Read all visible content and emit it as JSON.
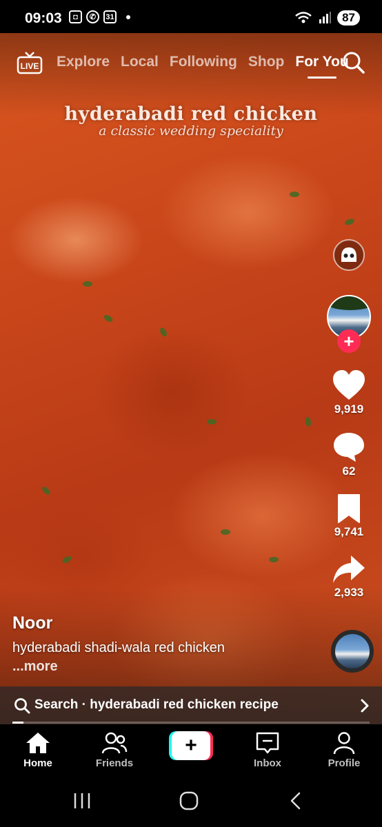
{
  "status_bar": {
    "time": "09:03",
    "calendar_day": "31",
    "battery": "87"
  },
  "top_nav": {
    "live_label": "LIVE",
    "tabs": [
      "Explore",
      "Local",
      "Following",
      "Shop",
      "For You"
    ],
    "active_tab": "For You"
  },
  "video_overlay": {
    "title": "hyderabadi red chicken",
    "subtitle": "a classic wedding speciality"
  },
  "actions": {
    "likes": "9,919",
    "comments": "62",
    "bookmarks": "9,741",
    "shares": "2,933"
  },
  "post": {
    "author": "Noor",
    "description": "hyderabadi shadi-wala red chicken",
    "more_label": "...more"
  },
  "search_suggestion": {
    "text": "Search · hyderabadi red chicken recipe"
  },
  "playback_progress": 0.03,
  "bottom_tabs": {
    "home": "Home",
    "friends": "Friends",
    "inbox": "Inbox",
    "profile": "Profile"
  },
  "colors": {
    "accent": "#fe2c55",
    "accent_alt": "#25f4ee"
  },
  "icons": [
    "live-icon",
    "search-icon",
    "effect-icon",
    "heart-icon",
    "comment-icon",
    "bookmark-icon",
    "share-icon",
    "chevron-right-icon",
    "home-icon",
    "friends-icon",
    "plus-icon",
    "inbox-icon",
    "profile-icon"
  ]
}
